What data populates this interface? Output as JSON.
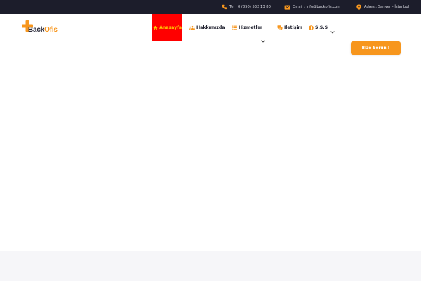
{
  "topbar": {
    "phone": "Tel : 0 (850) 532 13 80",
    "email": "Email : info@backofis.com",
    "address": "Adres : Sarıyer - İstanbul",
    "icons": {
      "phone": "phone-icon",
      "email": "envelope-icon",
      "address": "map-pin-icon"
    },
    "accent": "#f7961d",
    "background": "#1c1d2b"
  },
  "logo": {
    "part1": "Back",
    "part2": "Ofis",
    "icon": "plus-icon"
  },
  "nav": {
    "home": "Anasayfa",
    "about": "Hakkımızda",
    "services": "Hizmetler",
    "contact": "İletişim",
    "faq": "S.S.S",
    "icons": {
      "home": "home-icon",
      "about": "users-icon",
      "services": "list-icon",
      "contact": "chat-icon",
      "faq": "info-icon"
    },
    "active_background": "#ff0000",
    "active_color": "#ffcc00"
  },
  "cta": {
    "label": "Bize Sorun !",
    "color": "#f7961d"
  }
}
